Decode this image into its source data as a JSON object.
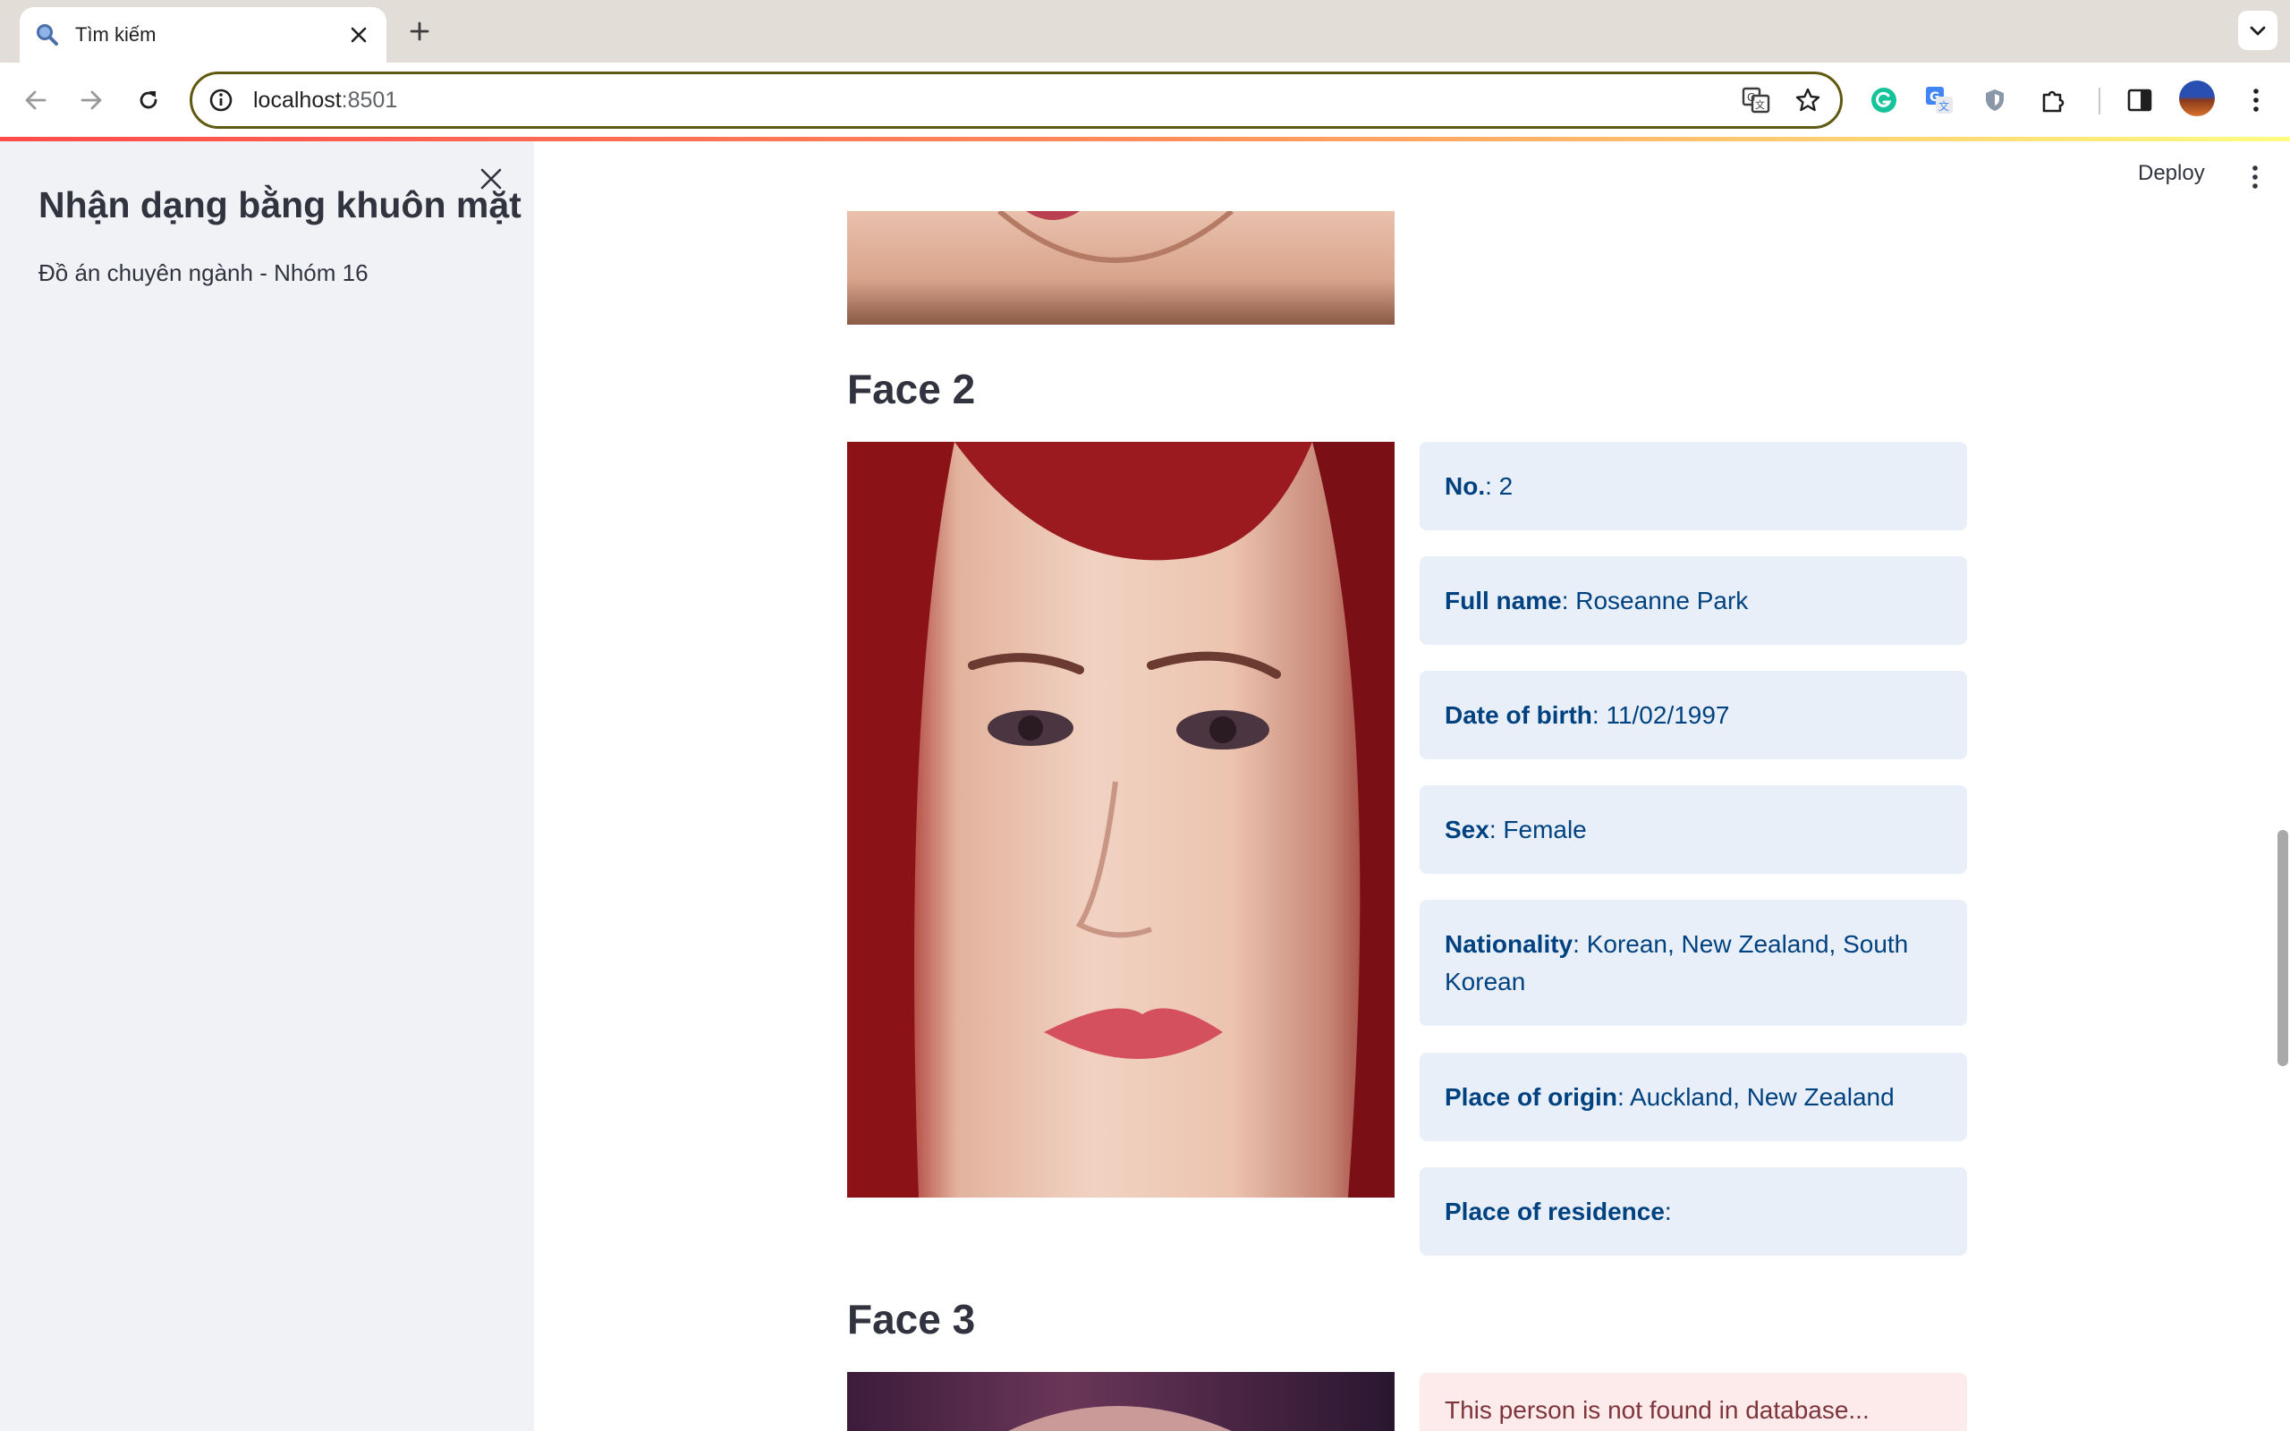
{
  "browser": {
    "tab_title": "Tìm kiếm",
    "url_host": "localhost",
    "url_port": ":8501"
  },
  "sidebar": {
    "title": "Nhận dạng bằng khuôn mặt",
    "subtitle": "Đồ án chuyên ngành - Nhóm 16"
  },
  "header": {
    "deploy_label": "Deploy"
  },
  "faces": {
    "face2_heading": "Face 2",
    "face3_heading": "Face 3"
  },
  "info": {
    "no_label": "No.",
    "no_value": ": 2",
    "fullname_label": "Full name",
    "fullname_value": ": Roseanne Park",
    "dob_label": "Date of birth",
    "dob_value": ": 11/02/1997",
    "sex_label": "Sex",
    "sex_value": ": Female",
    "nationality_label": "Nationality",
    "nationality_value": ": Korean, New Zealand, South Korean",
    "origin_label": "Place of origin",
    "origin_value": ": Auckland, New Zealand",
    "residence_label": "Place of residence",
    "residence_value": ":"
  },
  "error": {
    "message": "This person is not found in database..."
  },
  "colors": {
    "accent_gradient": [
      "#ff4b4b",
      "#fffd80"
    ],
    "info_bg": "#e8eff9",
    "info_text": "#004280",
    "error_bg": "#fdebeb",
    "error_text": "#7d353b",
    "sidebar_bg": "#f0f2f6"
  },
  "icons": {
    "tab": "search-icon",
    "close": "close-icon",
    "new_tab": "plus-icon",
    "back": "back-arrow-icon",
    "forward": "forward-arrow-icon",
    "reload": "reload-icon",
    "site_info": "info-icon",
    "translate": "translate-icon",
    "bookmark": "star-icon",
    "extensions": [
      "grammarly-icon",
      "google-translate-icon",
      "shield-icon",
      "puzzle-icon",
      "side-panel-icon"
    ],
    "menu": "kebab-menu-icon"
  }
}
